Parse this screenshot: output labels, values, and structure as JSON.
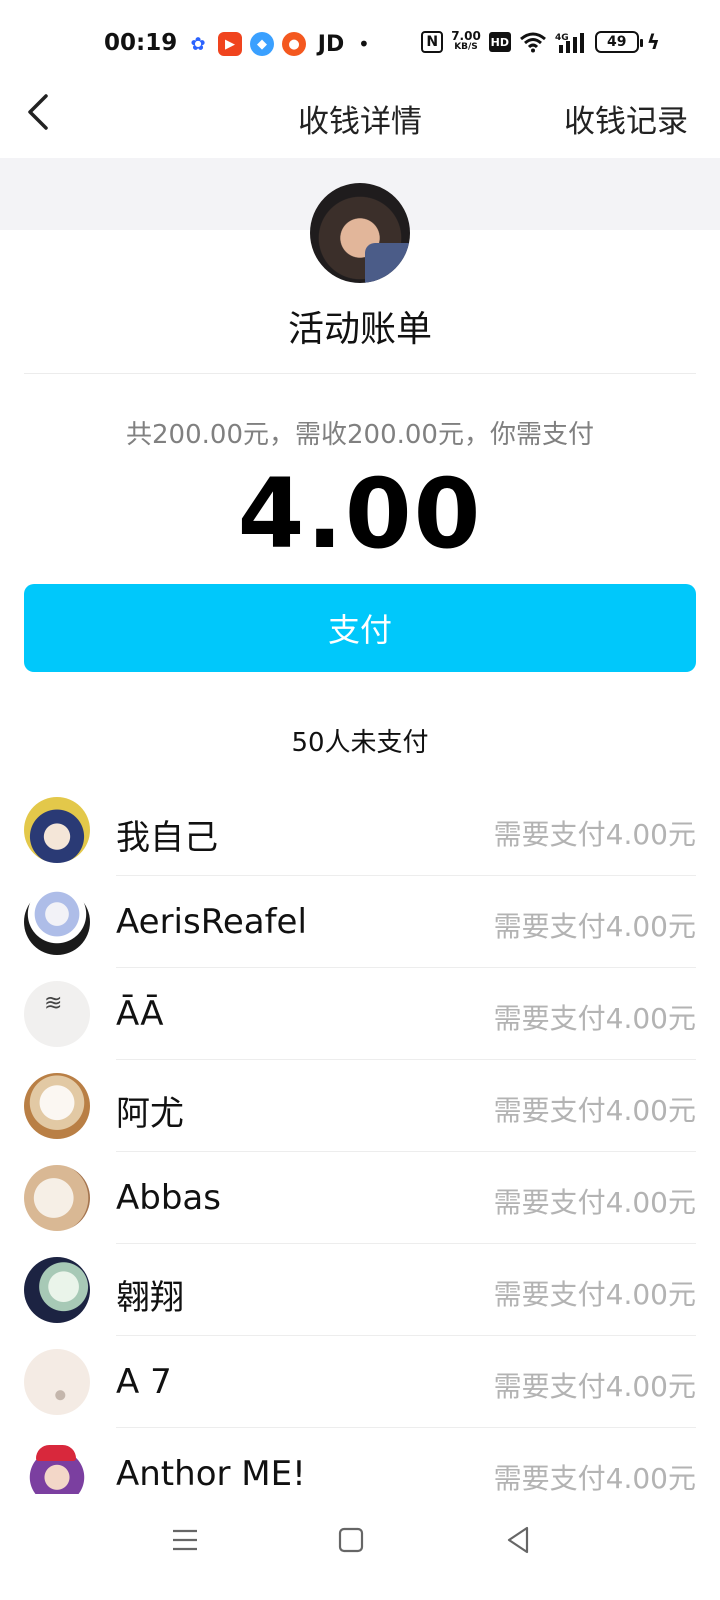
{
  "status_bar": {
    "time": "00:19",
    "jd_label": "JD",
    "dot": "•",
    "nfc_label": "N",
    "speed_value": "7.00",
    "speed_unit": "KB/S",
    "hd_label": "HD",
    "network_label": "4G",
    "battery": "49",
    "icons": [
      "baidu-icon",
      "video-app-icon",
      "blue-app-icon",
      "orange-app-icon",
      "nfc-icon",
      "wifi-icon",
      "signal-icon",
      "battery-icon",
      "charging-icon"
    ]
  },
  "nav": {
    "title": "收钱详情",
    "right_link": "收钱记录"
  },
  "bill": {
    "title": "活动账单",
    "summary": "共200.00元，需收200.00元，你需支付",
    "amount": "4.00",
    "pay_button": "支付",
    "unpaid_count": "50人未支付"
  },
  "members": [
    {
      "name": "我自己",
      "due": "需要支付4.00元"
    },
    {
      "name": "AerisReafel",
      "due": "需要支付4.00元"
    },
    {
      "name": "ĀĀ",
      "due": "需要支付4.00元"
    },
    {
      "name": "阿尤",
      "due": "需要支付4.00元"
    },
    {
      "name": "Abbas",
      "due": "需要支付4.00元"
    },
    {
      "name": "翱翔",
      "due": "需要支付4.00元"
    },
    {
      "name": "A 7",
      "due": "需要支付4.00元"
    },
    {
      "name": "Anthor ME!",
      "due": "需要支付4.00元"
    }
  ],
  "colors": {
    "accent": "#00c8fb",
    "muted_text": "#b3b3b3",
    "band": "#f3f3f6"
  }
}
